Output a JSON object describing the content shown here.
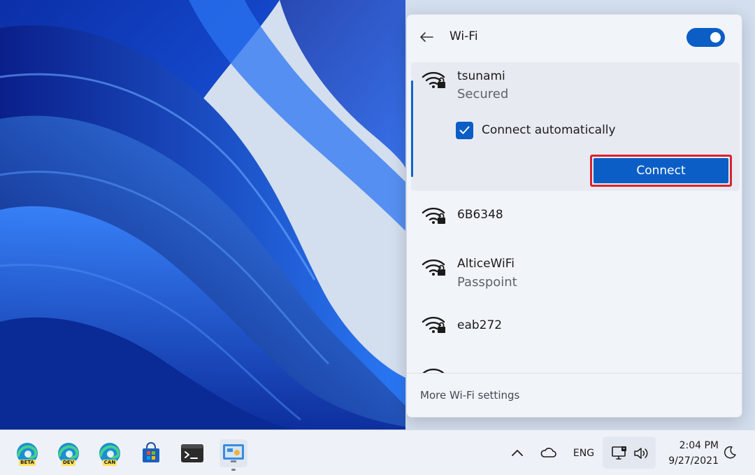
{
  "flyout": {
    "title": "Wi-Fi",
    "toggle_state": "on",
    "networks": [
      {
        "ssid": "tsunami",
        "status": "Secured",
        "connect_automatically_label": "Connect automatically",
        "connect_automatically_checked": true,
        "connect_button_label": "Connect",
        "secured": true
      },
      {
        "ssid": "6B6348",
        "status": "",
        "secured": true
      },
      {
        "ssid": "AlticeWiFi",
        "status": "Passpoint",
        "secured": true
      },
      {
        "ssid": "eab272",
        "status": "",
        "secured": true
      }
    ],
    "footer_link": "More Wi-Fi settings"
  },
  "taskbar": {
    "apps": [
      {
        "name": "edge-beta",
        "badge": "BETA",
        "icon": "edge-icon"
      },
      {
        "name": "edge-dev",
        "badge": "DEV",
        "icon": "edge-icon"
      },
      {
        "name": "edge-canary",
        "badge": "CAN",
        "icon": "edge-icon"
      },
      {
        "name": "microsoft-store",
        "icon": "store-icon"
      },
      {
        "name": "terminal",
        "icon": "terminal-icon"
      },
      {
        "name": "control-panel",
        "icon": "control-panel-icon"
      }
    ],
    "tray": {
      "language": "ENG",
      "time": "2:04 PM",
      "date": "9/27/2021"
    }
  },
  "colors": {
    "accent": "#0a5ec6",
    "highlight_border": "#d8232f",
    "taskbar_bg": "#eef2f8"
  }
}
